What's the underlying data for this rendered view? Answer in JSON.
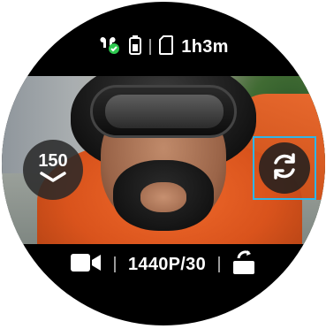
{
  "status_bar": {
    "icons": [
      "earbuds-connected-icon",
      "battery-icon",
      "sd-card-icon"
    ],
    "remaining_time": "1h3m",
    "connected_badge_color": "#2ec84f"
  },
  "zoom": {
    "value": "150",
    "icon": "chevron-down-icon"
  },
  "flip_camera": {
    "icon": "switch-camera-icon",
    "highlight_color": "#2fb5e8"
  },
  "bottom_bar": {
    "mode_icon": "video-camera-icon",
    "resolution": "1440P/30",
    "rotate_icon": "screen-rotate-icon"
  }
}
